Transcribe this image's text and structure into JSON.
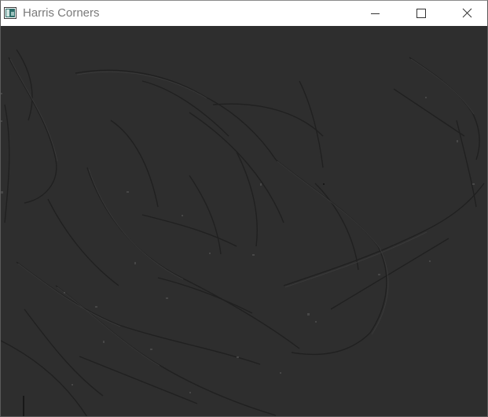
{
  "window": {
    "title": "Harris Corners",
    "title_color": "#7a7a7a",
    "background_color": "#2e2e2e",
    "icons": {
      "app": "image-window-icon",
      "minimize": "minimize-icon",
      "maximize": "maximize-icon",
      "close": "close-icon"
    }
  }
}
